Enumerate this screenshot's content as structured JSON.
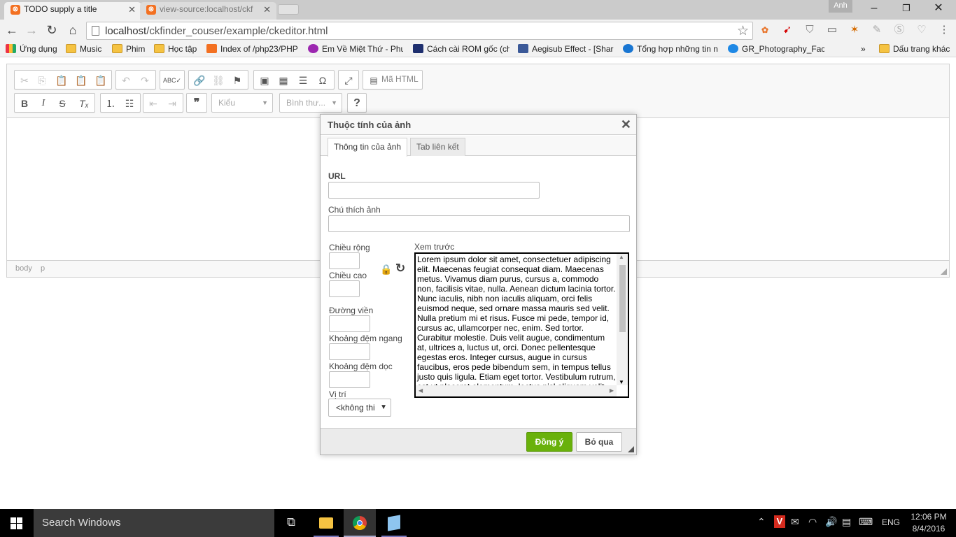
{
  "browser": {
    "tabs": [
      {
        "title": "TODO supply a title",
        "active": true
      },
      {
        "title": "view-source:localhost/ckf",
        "active": false
      }
    ],
    "user_badge": "Anh",
    "url_host": "localhost",
    "url_path": "/ckfinder_couser/example/ckeditor.html",
    "bookmarks": [
      {
        "label": "Ứng dụng",
        "icon": "apps-icon"
      },
      {
        "label": "Music",
        "icon": "folder-icon"
      },
      {
        "label": "Phim",
        "icon": "folder-icon"
      },
      {
        "label": "Học tập",
        "icon": "folder-icon"
      },
      {
        "label": "Index of /php23/PHP",
        "icon": "xampp-icon"
      },
      {
        "label": "Em Về Miệt Thứ - Phu",
        "icon": "site-icon"
      },
      {
        "label": "Cách cài ROM gốc (ch",
        "icon": "site-icon"
      },
      {
        "label": "Aegisub Effect - [Shar",
        "icon": "facebook-icon"
      },
      {
        "label": "Tổng hợp những tin n",
        "icon": "site-icon"
      },
      {
        "label": "GR_Photography_Face",
        "icon": "site-icon"
      }
    ],
    "other_bookmarks": "Dấu trang khác",
    "more_bookmarks": "»"
  },
  "editor": {
    "toolbar": {
      "source_label": "Mã HTML",
      "style_combo": "Kiểu",
      "format_combo": "Bình thư...",
      "help_label": "?"
    },
    "path": [
      "body",
      "p"
    ]
  },
  "dialog": {
    "title": "Thuộc tính của ảnh",
    "tabs": [
      "Thông tin của ảnh",
      "Tab liên kết"
    ],
    "url_label": "URL",
    "alt_label": "Chú thích ảnh",
    "width_label": "Chiều rộng",
    "height_label": "Chiều cao",
    "border_label": "Đường viền",
    "hspace_label": "Khoảng đệm ngang",
    "vspace_label": "Khoảng đệm dọc",
    "align_label": "Vị trí",
    "align_value": "<không thi",
    "preview_label": "Xem trước",
    "preview_text": "Lorem ipsum dolor sit amet, consectetuer adipiscing elit. Maecenas feugiat consequat diam. Maecenas metus. Vivamus diam purus, cursus a, commodo non, facilisis vitae, nulla. Aenean dictum lacinia tortor. Nunc iaculis, nibh non iaculis aliquam, orci felis euismod neque, sed ornare massa mauris sed velit. Nulla pretium mi et risus. Fusce mi pede, tempor id, cursus ac, ullamcorper nec, enim. Sed tortor. Curabitur molestie. Duis velit augue, condimentum at, ultrices a, luctus ut, orci. Donec pellentesque egestas eros. Integer cursus, augue in cursus faucibus, eros pede bibendum sem, in tempus tellus justo quis ligula. Etiam eget tortor. Vestibulum rutrum, est ut placerat elementum, lectus nisl aliquam velit, tempor aliquam eros nunc nonummy metus.",
    "ok_label": "Đồng ý",
    "cancel_label": "Bỏ qua"
  },
  "taskbar": {
    "search_placeholder": "Search Windows",
    "lang": "ENG",
    "time": "12:06 PM",
    "date": "8/4/2016"
  },
  "colors": {
    "ok_button": "#69b10b",
    "dialog_header": "#f8f8f8",
    "taskbar": "#000000"
  }
}
